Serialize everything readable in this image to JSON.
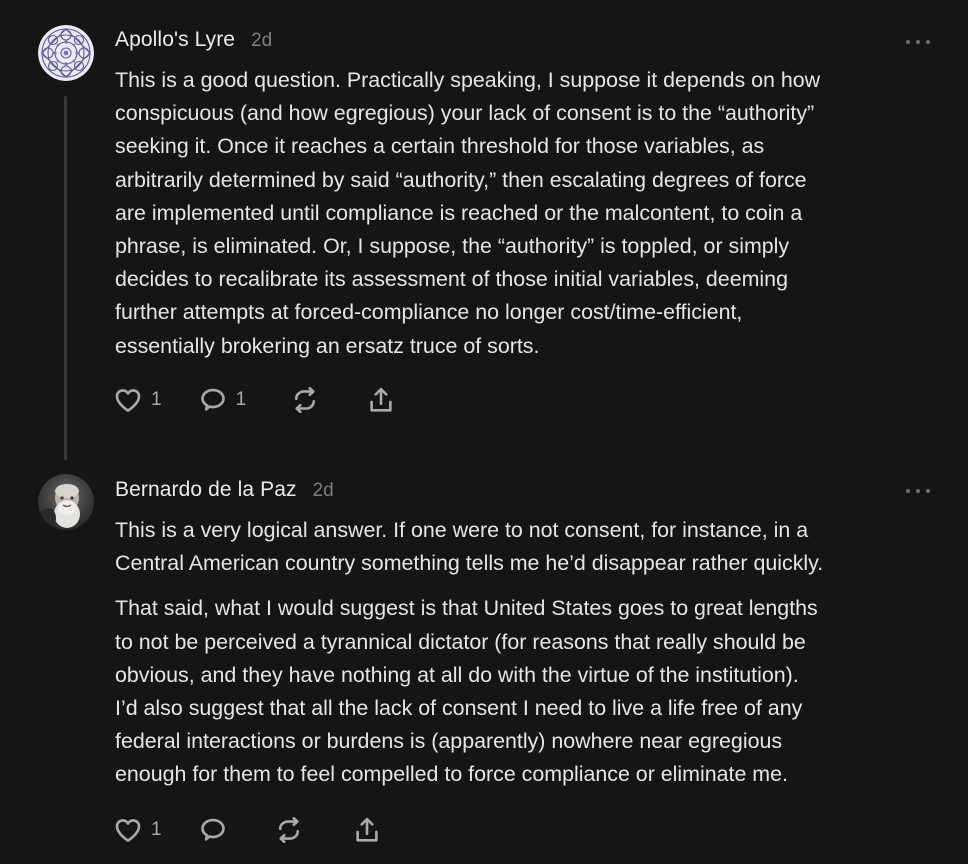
{
  "comments": [
    {
      "author": "Apollo's Lyre",
      "time": "2d",
      "lines": [
        "This is a good question. Practically speaking, I suppose it depends on how",
        "conspicuous (and how egregious) your lack of consent is to the “authority”",
        "seeking it. Once it reaches a certain threshold for those variables, as",
        "arbitrarily determined by said “authority,” then escalating degrees of force",
        "are implemented until compliance is reached or the malcontent, to coin a",
        "phrase, is eliminated. Or, I suppose, the “authority” is toppled, or simply",
        "decides to recalibrate its assessment of those initial variables, deeming",
        "further attempts at forced-compliance no longer cost/time-efficient,",
        "essentially brokering an ersatz truce of sorts."
      ],
      "like_count": "1",
      "reply_count": "1"
    },
    {
      "author": "Bernardo de la Paz",
      "time": "2d",
      "para1": [
        "This is a very logical answer. If one were to not consent, for instance, in a",
        "Central American country something tells me he’d disappear rather quickly."
      ],
      "para2": [
        "That said, what I would suggest is that United States goes to great lengths",
        "to not be perceived a tyrannical dictator (for reasons that really should be",
        "obvious, and they have nothing at all do with the virtue of the institution).",
        "I’d also suggest that all the lack of consent I need to live a life free of any",
        "federal interactions or burdens is (apparently) nowhere near egregious",
        "enough for them to feel compelled to force compliance or eliminate me."
      ],
      "like_count": "1"
    }
  ]
}
